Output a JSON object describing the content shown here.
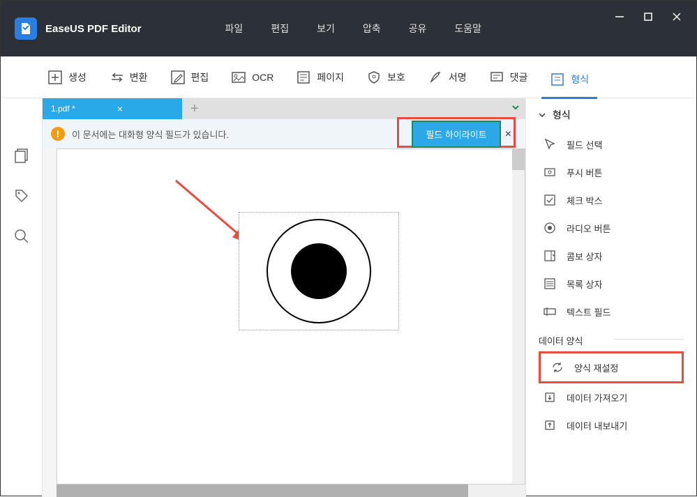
{
  "app": {
    "title": "EaseUS PDF Editor"
  },
  "menu": {
    "file": "파일",
    "edit": "편집",
    "view": "보기",
    "compress": "압축",
    "share": "공유",
    "help": "도움말"
  },
  "toolbar": {
    "create": "생성",
    "convert": "변환",
    "edit": "편집",
    "ocr": "OCR",
    "page": "페이지",
    "protect": "보호",
    "sign": "서명",
    "comment": "댓글",
    "form": "형식"
  },
  "tab": {
    "name": "1.pdf *"
  },
  "info": {
    "text": "이 문서에는 대화형 양식 필드가 있습니다.",
    "highlight_btn": "필드 하이라이트"
  },
  "panel": {
    "header": "형식",
    "items": {
      "select": "필드 선택",
      "push": "푸시 버튼",
      "check": "체크 박스",
      "radio": "라디오 버튼",
      "combo": "콤보 상자",
      "list": "목록 상자",
      "text": "텍스트 필드"
    },
    "section_data": "데이터 양식",
    "reset": "양식 재설정",
    "import": "데이터 가져오기",
    "export": "데이터 내보내기"
  }
}
